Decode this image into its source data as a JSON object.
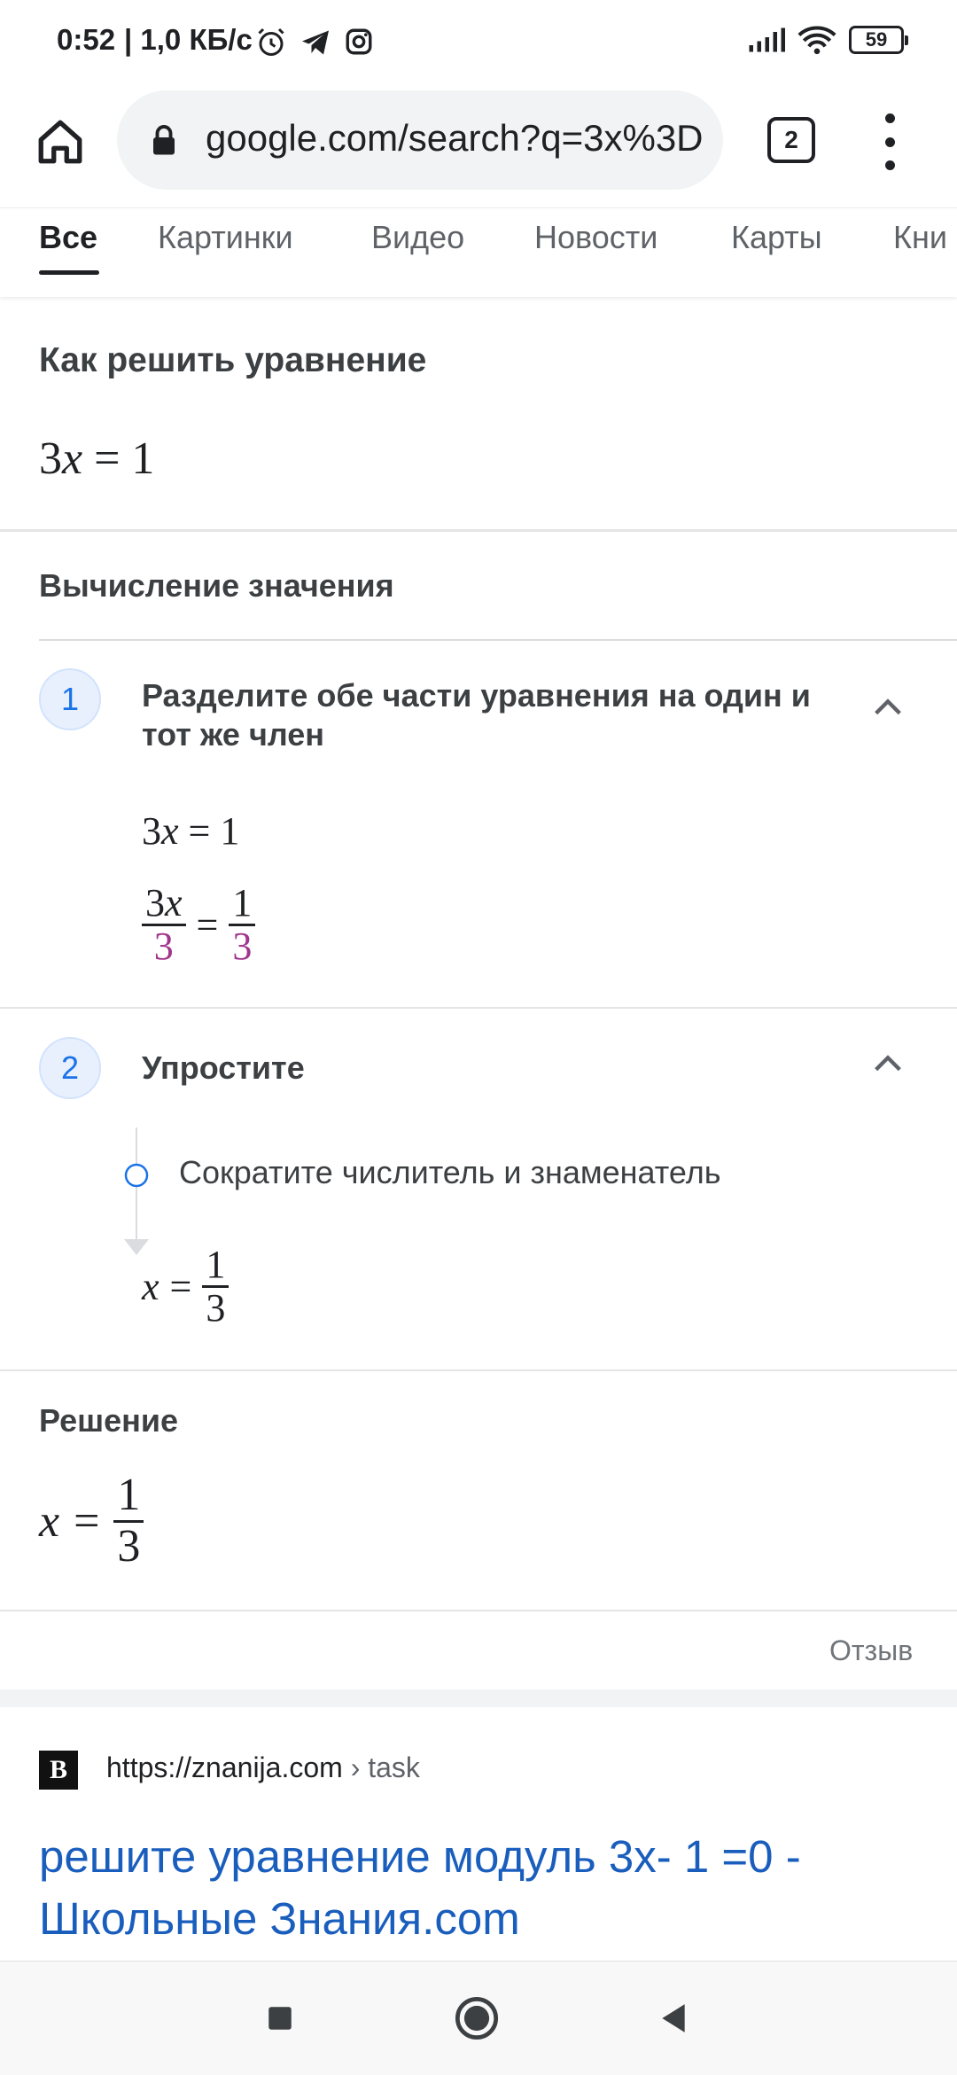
{
  "status_bar": {
    "time": "0:52",
    "network_speed": "| 1,0 КБ/с",
    "battery": "59",
    "icons": [
      "alarm-icon",
      "telegram-icon",
      "instagram-icon",
      "signal-icon",
      "wifi-icon",
      "battery-icon"
    ]
  },
  "browser": {
    "url": "google.com/search?q=3x%3D",
    "tab_count": "2"
  },
  "search_tabs": [
    "Все",
    "Картинки",
    "Видео",
    "Новости",
    "Карты",
    "Кни"
  ],
  "solver": {
    "title": "Как решить уравнение",
    "equation": {
      "lhs": "3",
      "var": "x",
      "op": "=",
      "rhs": "1"
    },
    "section_label": "Вычисление значения",
    "step1": {
      "number": "1",
      "title": "Разделите обе части уравнения на один и тот же член",
      "line1": {
        "lhs": "3",
        "var": "x",
        "op": "=",
        "rhs": "1"
      },
      "line2": {
        "num_left": "3",
        "var": "x",
        "den_left": "3",
        "op": "=",
        "num_right": "1",
        "den_right": "3"
      }
    },
    "step2": {
      "number": "2",
      "title": "Упростите",
      "substep": "Сократите числитель и знаменатель",
      "result": {
        "var": "x",
        "op": "=",
        "num": "1",
        "den": "3"
      }
    },
    "solution_label": "Решение",
    "solution": {
      "var": "x",
      "op": "=",
      "num": "1",
      "den": "3"
    },
    "feedback": "Отзыв"
  },
  "result": {
    "favicon": "B",
    "site": "https://znanija.com",
    "path": " › task",
    "title": "решите уравнение модуль 3x- 1 =0 - Школьные Знания.com"
  },
  "colors": {
    "link": "#1a5ebd",
    "accent": "#1a73e8",
    "divisor": "#a0378e"
  }
}
